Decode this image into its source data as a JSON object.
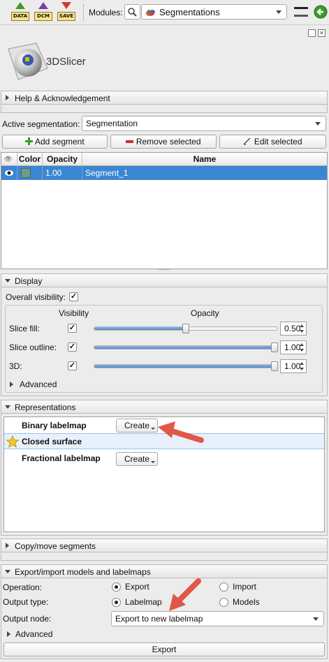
{
  "toolbar": {
    "data_label": "DATA",
    "dcm_label": "DCM",
    "save_label": "SAVE",
    "modules_label": "Modules:",
    "module_selected": "Segmentations"
  },
  "logo": {
    "text": "3DSlicer"
  },
  "help": {
    "title": "Help & Acknowledgement"
  },
  "active": {
    "label": "Active segmentation:",
    "value": "Segmentation"
  },
  "actions": {
    "add": "Add segment",
    "remove": "Remove selected",
    "edit": "Edit selected"
  },
  "table": {
    "headers": {
      "color": "Color",
      "opacity": "Opacity",
      "name": "Name"
    },
    "rows": [
      {
        "opacity": "1.00",
        "name": "Segment_1",
        "color": "#6f9a8a"
      }
    ]
  },
  "display": {
    "title": "Display",
    "overall": "Overall visibility:",
    "col_visibility": "Visibility",
    "col_opacity": "Opacity",
    "rows": [
      {
        "label": "Slice fill:",
        "value": "0.50",
        "level": 0.5
      },
      {
        "label": "Slice outline:",
        "value": "1.00",
        "level": 1.0
      },
      {
        "label": "3D:",
        "value": "1.00",
        "level": 1.0
      }
    ],
    "advanced": "Advanced"
  },
  "representations": {
    "title": "Representations",
    "rows": [
      {
        "name": "Binary labelmap",
        "button": "Create"
      },
      {
        "name": "Closed surface"
      },
      {
        "name": "Fractional labelmap",
        "button": "Create"
      }
    ]
  },
  "copymove": {
    "title": "Copy/move segments"
  },
  "export": {
    "title": "Export/import models and labelmaps",
    "operation_label": "Operation:",
    "op_export": "Export",
    "op_import": "Import",
    "type_label": "Output type:",
    "type_labelmap": "Labelmap",
    "type_models": "Models",
    "node_label": "Output node:",
    "node_value": "Export to new labelmap",
    "advanced": "Advanced",
    "button": "Export"
  },
  "colors": {
    "selection": "#3b86d1",
    "arrow": "#e0584a"
  }
}
